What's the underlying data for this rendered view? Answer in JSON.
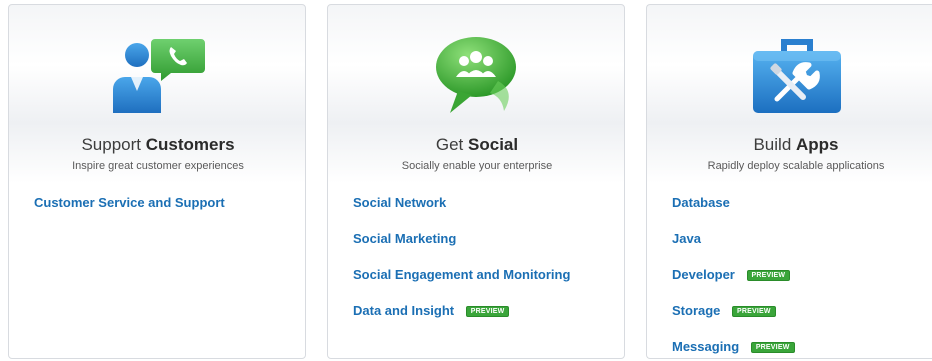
{
  "cards": [
    {
      "icon": "person-phone-icon",
      "title_pre": "Support",
      "title_bold": "Customers",
      "subtitle": "Inspire great customer experiences",
      "links": [
        {
          "label": "Customer Service and Support",
          "badge": ""
        }
      ]
    },
    {
      "icon": "social-bubble-icon",
      "title_pre": "Get",
      "title_bold": "Social",
      "subtitle": "Socially enable your enterprise",
      "links": [
        {
          "label": "Social Network",
          "badge": ""
        },
        {
          "label": "Social Marketing",
          "badge": ""
        },
        {
          "label": "Social Engagement and Monitoring",
          "badge": ""
        },
        {
          "label": "Data and Insight",
          "badge": "PREVIEW"
        }
      ]
    },
    {
      "icon": "toolbox-icon",
      "title_pre": "Build",
      "title_bold": "Apps",
      "subtitle": "Rapidly deploy scalable applications",
      "links": [
        {
          "label": "Database",
          "badge": ""
        },
        {
          "label": "Java",
          "badge": ""
        },
        {
          "label": "Developer",
          "badge": "PREVIEW"
        },
        {
          "label": "Storage",
          "badge": "PREVIEW"
        },
        {
          "label": "Messaging",
          "badge": "PREVIEW"
        }
      ]
    }
  ],
  "colors": {
    "link": "#1b6fb4",
    "badge": "#3aa53a",
    "icon_blue": "#2f8fd8",
    "icon_green": "#4cb84c"
  }
}
